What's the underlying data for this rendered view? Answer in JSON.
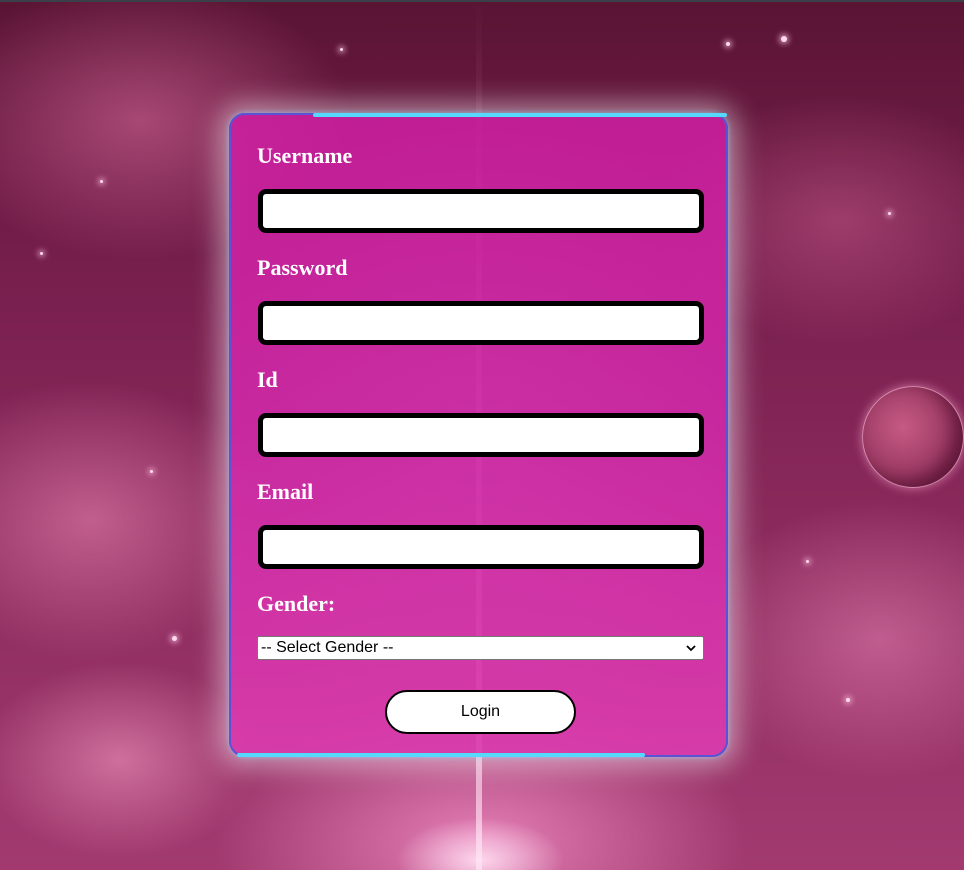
{
  "form": {
    "username_label": "Username",
    "username_value": "",
    "password_label": "Password",
    "password_value": "",
    "id_label": "Id",
    "id_value": "",
    "email_label": "Email",
    "email_value": "",
    "gender_label": "Gender:",
    "gender_selected": "-- Select Gender --",
    "login_label": "Login"
  },
  "icons": {
    "select_arrow": "chevron-down-icon"
  },
  "colors": {
    "card_fill": "#d21ea6",
    "card_border": "#5a53d6",
    "accent": "#55d9ff",
    "label_text": "#ffffff",
    "field_border": "#000000"
  }
}
